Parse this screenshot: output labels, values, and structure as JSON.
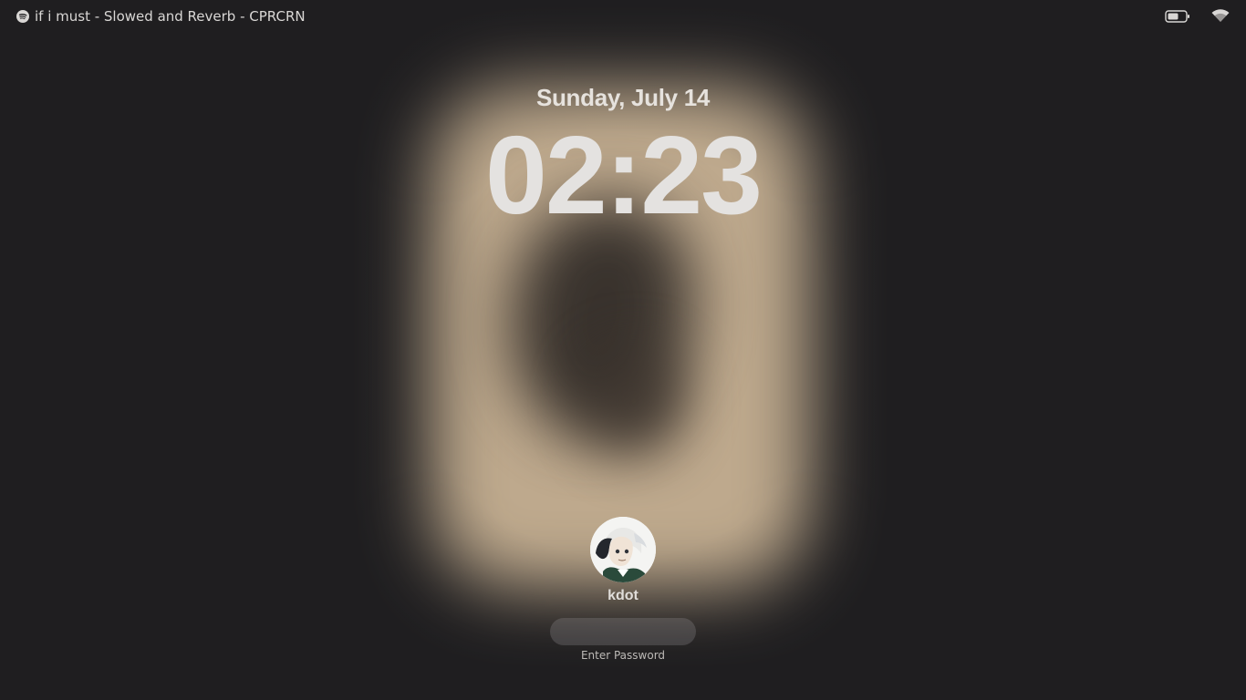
{
  "topbar": {
    "now_playing": "if i must - Slowed and Reverb - CPRCRN",
    "now_playing_icon": "spotify-icon",
    "battery_icon": "battery-icon",
    "wifi_icon": "wifi-icon"
  },
  "clock": {
    "date": "Sunday, July 14",
    "time": "02:23"
  },
  "user": {
    "name": "kdot",
    "avatar_icon": "avatar",
    "password_hint": "Enter Password"
  },
  "colors": {
    "background": "#1f1e20",
    "glow": "#c7b193",
    "text": "#e4e2e0"
  }
}
